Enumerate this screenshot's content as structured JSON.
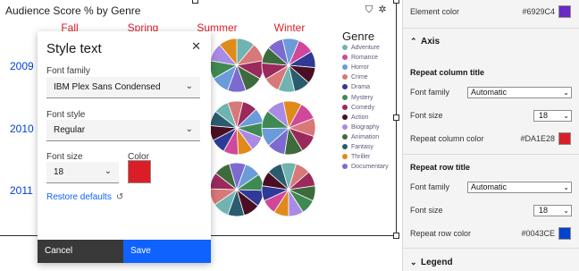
{
  "chart": {
    "title": "Audience Score % by Genre",
    "toolbar": {
      "filter_icon": "filter-icon",
      "settings_icon": "gear-icon"
    },
    "column_titles": [
      "Fall",
      "Spring",
      "Summer",
      "Winter"
    ],
    "row_titles": [
      "2009",
      "2010",
      "2011"
    ],
    "legend": {
      "title": "Genre",
      "items": [
        {
          "label": "Adventure",
          "color": "#6fb4b0"
        },
        {
          "label": "Romance",
          "color": "#d0489b"
        },
        {
          "label": "Horror",
          "color": "#6b9bd9"
        },
        {
          "label": "Crime",
          "color": "#d87878"
        },
        {
          "label": "Drama",
          "color": "#2f3a96"
        },
        {
          "label": "Mystery",
          "color": "#3f8a52"
        },
        {
          "label": "Comedy",
          "color": "#9b2a5c"
        },
        {
          "label": "Action",
          "color": "#4a0f22"
        },
        {
          "label": "Biography",
          "color": "#a98be6"
        },
        {
          "label": "Animation",
          "color": "#3e6b3e"
        },
        {
          "label": "Fantasy",
          "color": "#2b5b6e"
        },
        {
          "label": "Thriller",
          "color": "#e08a1c"
        },
        {
          "label": "Documentary",
          "color": "#7c6ad0"
        }
      ]
    }
  },
  "dialog": {
    "title": "Style text",
    "close_icon": "close-icon",
    "font_family_label": "Font family",
    "font_family_value": "IBM Plex Sans Condensed",
    "font_style_label": "Font style",
    "font_style_value": "Regular",
    "font_size_label": "Font size",
    "font_size_value": "18",
    "color_label": "Color",
    "color_value": "#DA1E28",
    "restore_label": "Restore defaults",
    "restore_icon": "reset-icon",
    "cancel_label": "Cancel",
    "save_label": "Save"
  },
  "panel": {
    "element_color": {
      "label": "Element color",
      "value": "#6929C4"
    },
    "axis_section": "Axis",
    "repeat_column_title": {
      "heading": "Repeat column title",
      "font_family_label": "Font family",
      "font_family_value": "Automatic",
      "font_size_label": "Font size",
      "font_size_value": "18",
      "color_label": "Repeat column color",
      "color_value": "#DA1E28"
    },
    "repeat_row_title": {
      "heading": "Repeat row title",
      "font_family_label": "Font family",
      "font_family_value": "Automatic",
      "font_size_label": "Font size",
      "font_size_value": "18",
      "color_label": "Repeat row color",
      "color_value": "#0043CE"
    },
    "legend_section": "Legend"
  }
}
